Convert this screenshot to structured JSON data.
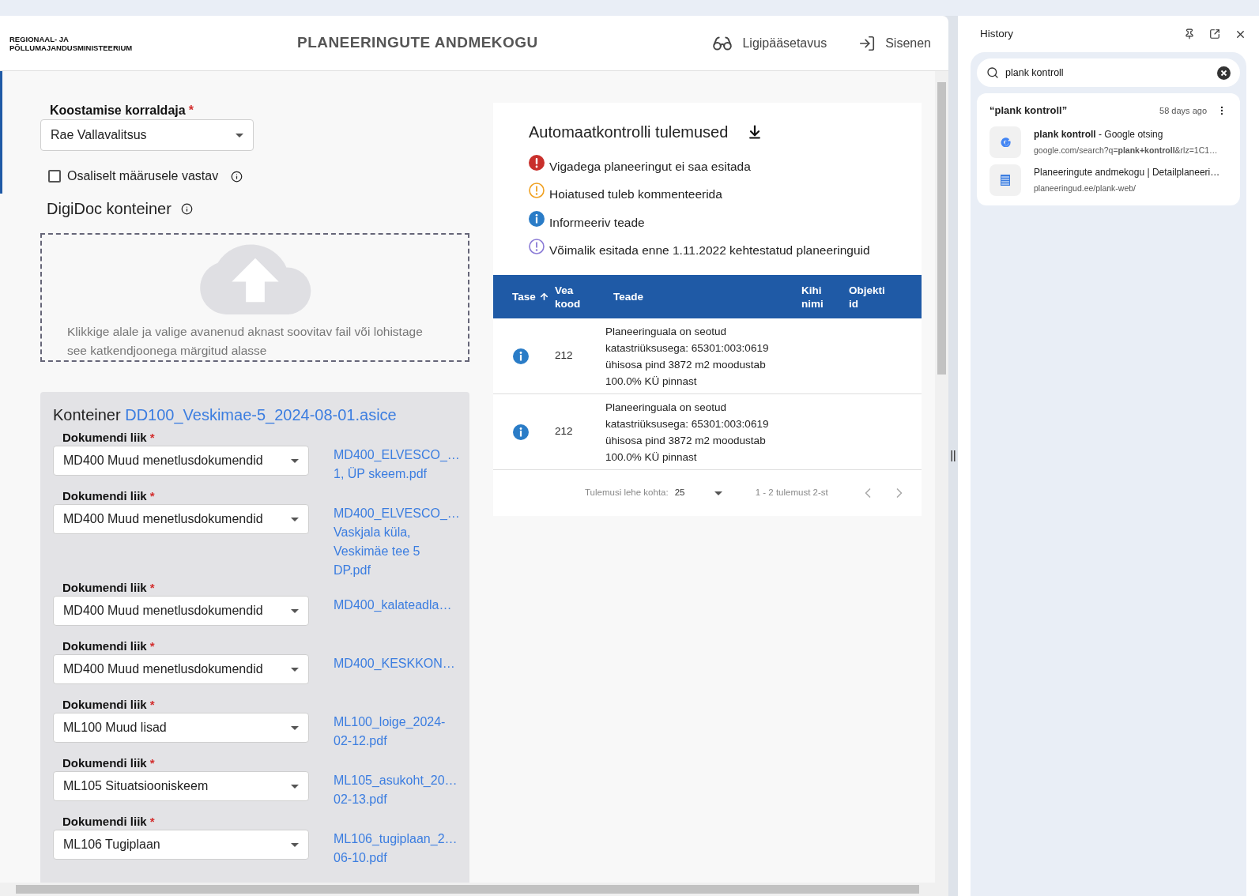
{
  "header": {
    "logo_lines": [
      "REGIONAAL- JA",
      "PÕLLUMAJANDUSMINISTEERIUM"
    ],
    "title": "PLANEERINGUTE ANDMEKOGU",
    "actions": [
      {
        "kind": "accessibility",
        "label": "Ligipääsetavus"
      },
      {
        "kind": "login",
        "label": "Sisenen"
      }
    ]
  },
  "form": {
    "organizer": {
      "label": "Koostamise korraldaja",
      "required": "*",
      "value": "Rae Vallavalitsus"
    },
    "partial": {
      "label": "Osaliselt määrusele vastav",
      "checked": false
    },
    "digidoc_title": "DigiDoc konteiner",
    "dropzone_hint": "Klikkige alale ja valige avanenud aknast soovitav fail või lohistage see katkendjoonega märgitud alasse",
    "container": {
      "label": "Konteiner",
      "file": "DD100_Veskimae-5_2024-08-01.asice"
    },
    "documents": [
      {
        "label": "Dokumendi liik",
        "required": "*",
        "value": "MD400 Muud menetlusdokumendid",
        "file_lines": [
          "MD400_ELVESCO_…",
          "1, ÜP skeem.pdf"
        ]
      },
      {
        "label": "Dokumendi liik",
        "required": "*",
        "value": "MD400 Muud menetlusdokumendid",
        "file_lines": [
          "MD400_ELVESCO_…",
          "Vaskjala küla,",
          "Veskimäe tee 5",
          "DP.pdf"
        ]
      },
      {
        "label": "Dokumendi liik",
        "required": "*",
        "value": "MD400 Muud menetlusdokumendid",
        "file_lines": [
          "MD400_kalateadla…"
        ]
      },
      {
        "label": "Dokumendi liik",
        "required": "*",
        "value": "MD400 Muud menetlusdokumendid",
        "file_lines": [
          "MD400_KESKKON…"
        ]
      },
      {
        "label": "Dokumendi liik",
        "required": "*",
        "value": "ML100 Muud lisad",
        "file_lines": [
          "ML100_loige_2024-",
          "02-12.pdf"
        ]
      },
      {
        "label": "Dokumendi liik",
        "required": "*",
        "value": "ML105 Situatsiooniskeem",
        "file_lines": [
          "ML105_asukoht_20…",
          "02-13.pdf"
        ]
      },
      {
        "label": "Dokumendi liik",
        "required": "*",
        "value": "ML106 Tugiplaan",
        "file_lines": [
          "ML106_tugiplaan_2…",
          "06-10.pdf"
        ]
      }
    ]
  },
  "results": {
    "title": "Automaatkontrolli tulemused",
    "legend": [
      {
        "kind": "error",
        "text": "Vigadega planeeringut ei saa esitada"
      },
      {
        "kind": "warning",
        "text": "Hoiatused tuleb kommenteerida"
      },
      {
        "kind": "info",
        "text": "Informeeriv teade"
      },
      {
        "kind": "legacy",
        "text": "Võimalik esitada enne 1.11.2022 kehtestatud planeeringuid"
      }
    ],
    "columns": [
      {
        "label": "Tase",
        "sorted": true
      },
      {
        "label": "Vea kood",
        "sorted": false
      },
      {
        "label": "Teade",
        "sorted": false
      },
      {
        "label": "Kihi nimi",
        "sorted": false
      },
      {
        "label": "Objekti id",
        "sorted": false
      }
    ],
    "rows": [
      {
        "kind": "info",
        "code": "212",
        "message": "Planeeringuala on seotud katastriüksusega: 65301:003:0619 ühisosa pind 3872 m2 moodustab 100.0% KÜ pinnast"
      },
      {
        "kind": "info",
        "code": "212",
        "message": "Planeeringuala on seotud katastriüksusega: 65301:003:0619 ühisosa pind 3872 m2 moodustab 100.0% KÜ pinnast"
      }
    ],
    "pagination": {
      "per_page_label": "Tulemusi lehe kohta:",
      "per_page": "25",
      "range": "1 - 2 tulemust 2-st"
    }
  },
  "history": {
    "title": "History",
    "search": "plank kontroll",
    "group": {
      "query": "“plank kontroll”",
      "ago": "58 days ago"
    },
    "entries": [
      {
        "kind": "google",
        "title": "**plank kontroll** - Google otsing",
        "url": "google.com/search?q=**plank+kontroll**&rlz=1C1…"
      },
      {
        "kind": "site",
        "title": "Planeeringute andmekogu | Detailplaneeri…",
        "url": "planeeringud.ee/plank-web/"
      }
    ]
  }
}
